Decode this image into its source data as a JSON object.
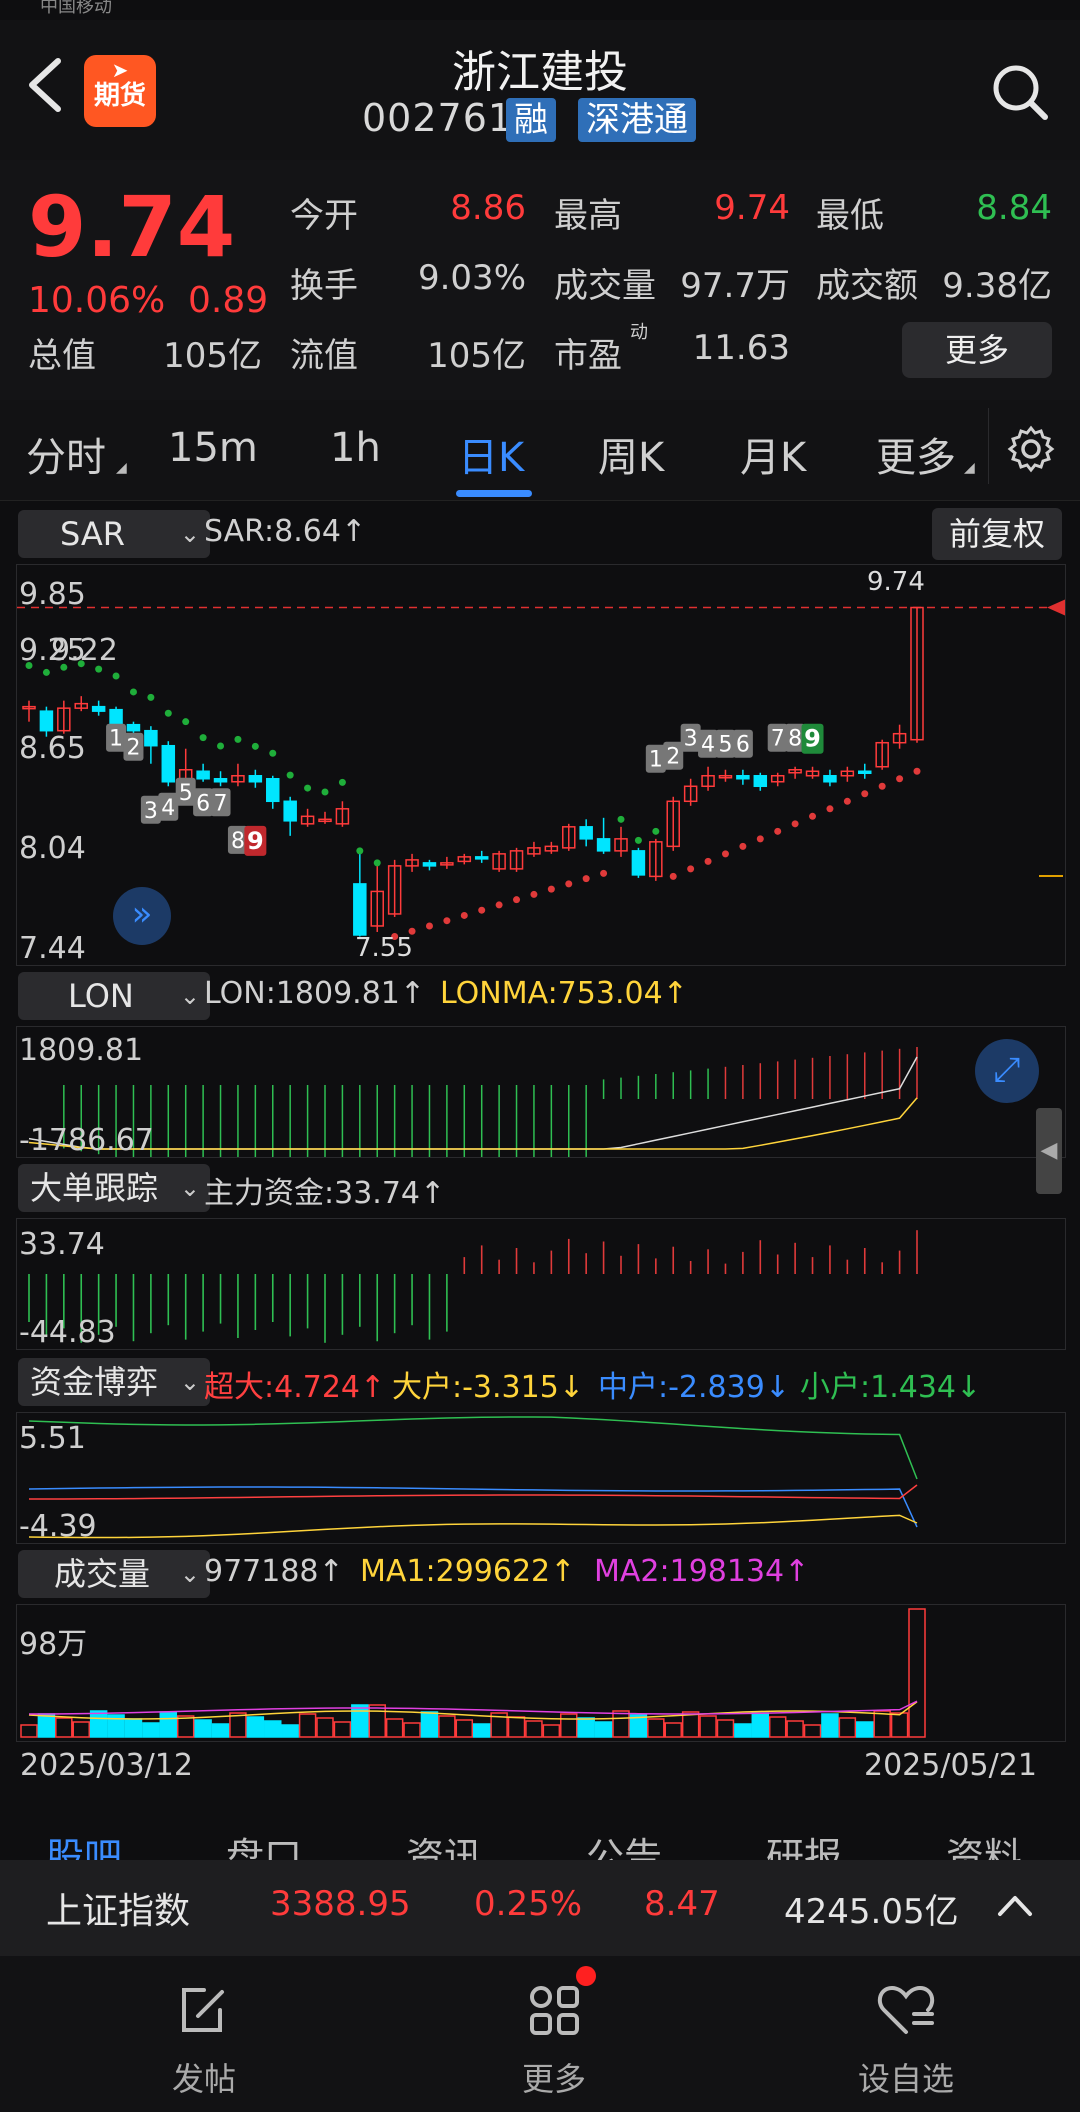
{
  "status": {
    "carrier": "中国移动"
  },
  "header": {
    "title": "浙江建投",
    "code": "002761",
    "tags": [
      "融",
      "深港通"
    ],
    "logo_label": "期货"
  },
  "quote": {
    "price": "9.74",
    "change_pct": "10.06%",
    "change": "0.89",
    "rows": [
      [
        {
          "label": "今开",
          "value": "8.86",
          "color": "red"
        },
        {
          "label": "最高",
          "value": "9.74",
          "color": "red"
        },
        {
          "label": "最低",
          "value": "8.84",
          "color": "green"
        }
      ],
      [
        {
          "label": "换手",
          "value": "9.03%",
          "color": "gray"
        },
        {
          "label": "成交量",
          "value": "97.7万",
          "color": "gray"
        },
        {
          "label": "成交额",
          "value": "9.38亿",
          "color": "gray"
        }
      ],
      [
        {
          "label": "流值",
          "value": "105亿",
          "color": "gray"
        },
        {
          "label": "市盈",
          "value": "11.63",
          "color": "gray"
        }
      ]
    ],
    "total_label": "总值",
    "total_value": "105亿",
    "pe_sup": "动",
    "more_button": "更多"
  },
  "period_tabs": [
    "分时",
    "15m",
    "1h",
    "日K",
    "周K",
    "月K",
    "更多"
  ],
  "active_tab": "日K",
  "sar_panel": {
    "selector": "SAR",
    "info": "SAR:8.64↑",
    "adjust_button": "前复权",
    "y_ticks": [
      "9.85",
      "9.25",
      "8.65",
      "8.04",
      "7.44"
    ],
    "high_label": "9.74",
    "low_label": "7.55",
    "overlap_label": "9.22"
  },
  "lon_panel": {
    "selector": "LON",
    "info_lon": "LON:1809.81↑",
    "info_lonma": "LONMA:753.04↑",
    "y_top": "1809.81",
    "y_bottom": "-1786.67"
  },
  "big_order_panel": {
    "selector": "大单跟踪",
    "info": "主力资金:33.74↑",
    "y_top": "33.74",
    "y_bottom": "-44.83"
  },
  "fund_game_panel": {
    "selector": "资金博弈",
    "info": [
      {
        "text": "超大:4.724↑",
        "color": "#ff4040"
      },
      {
        "text": "大户:-3.315↓",
        "color": "#ffd43b"
      },
      {
        "text": "中户:-2.839↓",
        "color": "#3a8cff"
      },
      {
        "text": "小户:1.434↓",
        "color": "#2fbf52"
      }
    ],
    "y_top": "5.51",
    "y_bottom": "-4.39"
  },
  "volume_panel": {
    "selector": "成交量",
    "info_vol": "977188↑",
    "info_ma1": "MA1:299622↑",
    "info_ma2": "MA2:198134↑",
    "y_top": "98万"
  },
  "dates": {
    "start": "2025/03/12",
    "end": "2025/05/21"
  },
  "bottom_tabs": [
    "股吧",
    "盘口",
    "资讯",
    "公告",
    "研报",
    "资料"
  ],
  "index_bar": {
    "name": "上证指数",
    "value": "3388.95",
    "pct": "0.25%",
    "change": "8.47",
    "amount": "4245.05亿"
  },
  "nav": [
    "发帖",
    "更多",
    "设自选"
  ],
  "colors": {
    "up": "#ff3b3b",
    "down": "#00e5ff",
    "accent": "#3a8cff",
    "sar_up": "#e03a3a",
    "sar_down": "#1fae3a"
  },
  "chart_data": {
    "type": "candlestick",
    "x_range": [
      "2025/03/12",
      "2025/05/21"
    ],
    "ylim": [
      7.44,
      9.85
    ],
    "price_high": 9.74,
    "price_low": 7.55,
    "candles": [
      {
        "o": 9.07,
        "c": 9.08,
        "h": 9.12,
        "l": 8.98
      },
      {
        "o": 9.05,
        "c": 8.92,
        "h": 9.08,
        "l": 8.88
      },
      {
        "o": 8.92,
        "c": 9.07,
        "h": 9.12,
        "l": 8.9
      },
      {
        "o": 9.07,
        "c": 9.1,
        "h": 9.15,
        "l": 9.05
      },
      {
        "o": 9.08,
        "c": 9.05,
        "h": 9.12,
        "l": 9.02
      },
      {
        "o": 9.06,
        "c": 8.96,
        "h": 9.08,
        "l": 8.94
      },
      {
        "o": 8.96,
        "c": 8.92,
        "h": 8.98,
        "l": 8.9
      },
      {
        "o": 8.92,
        "c": 8.82,
        "h": 8.95,
        "l": 8.7
      },
      {
        "o": 8.82,
        "c": 8.58,
        "h": 8.85,
        "l": 8.55
      },
      {
        "o": 8.6,
        "c": 8.66,
        "h": 8.8,
        "l": 8.58
      },
      {
        "o": 8.65,
        "c": 8.6,
        "h": 8.7,
        "l": 8.58
      },
      {
        "o": 8.6,
        "c": 8.58,
        "h": 8.65,
        "l": 8.55
      },
      {
        "o": 8.58,
        "c": 8.62,
        "h": 8.7,
        "l": 8.55
      },
      {
        "o": 8.62,
        "c": 8.58,
        "h": 8.66,
        "l": 8.54
      },
      {
        "o": 8.6,
        "c": 8.45,
        "h": 8.62,
        "l": 8.4
      },
      {
        "o": 8.45,
        "c": 8.32,
        "h": 8.48,
        "l": 8.22
      },
      {
        "o": 8.3,
        "c": 8.35,
        "h": 8.4,
        "l": 8.28
      },
      {
        "o": 8.33,
        "c": 8.33,
        "h": 8.38,
        "l": 8.3
      },
      {
        "o": 8.3,
        "c": 8.4,
        "h": 8.45,
        "l": 8.28
      },
      {
        "o": 7.9,
        "c": 7.56,
        "h": 8.1,
        "l": 7.55
      },
      {
        "o": 7.62,
        "c": 7.85,
        "h": 8.02,
        "l": 7.58
      },
      {
        "o": 7.7,
        "c": 8.02,
        "h": 8.06,
        "l": 7.68
      },
      {
        "o": 8.02,
        "c": 8.06,
        "h": 8.1,
        "l": 7.98
      },
      {
        "o": 8.04,
        "c": 8.02,
        "h": 8.06,
        "l": 7.99
      },
      {
        "o": 8.03,
        "c": 8.04,
        "h": 8.08,
        "l": 8.0
      },
      {
        "o": 8.05,
        "c": 8.08,
        "h": 8.1,
        "l": 8.03
      },
      {
        "o": 8.08,
        "c": 8.07,
        "h": 8.12,
        "l": 8.04
      },
      {
        "o": 8.0,
        "c": 8.1,
        "h": 8.12,
        "l": 7.98
      },
      {
        "o": 8.0,
        "c": 8.12,
        "h": 8.14,
        "l": 7.98
      },
      {
        "o": 8.1,
        "c": 8.14,
        "h": 8.18,
        "l": 8.08
      },
      {
        "o": 8.12,
        "c": 8.15,
        "h": 8.18,
        "l": 8.1
      },
      {
        "o": 8.14,
        "c": 8.28,
        "h": 8.3,
        "l": 8.12
      },
      {
        "o": 8.28,
        "c": 8.2,
        "h": 8.33,
        "l": 8.15
      },
      {
        "o": 8.2,
        "c": 8.12,
        "h": 8.34,
        "l": 8.1
      },
      {
        "o": 8.12,
        "c": 8.2,
        "h": 8.28,
        "l": 8.08
      },
      {
        "o": 8.12,
        "c": 7.96,
        "h": 8.14,
        "l": 7.94
      },
      {
        "o": 7.95,
        "c": 8.18,
        "h": 8.2,
        "l": 7.92
      },
      {
        "o": 8.15,
        "c": 8.45,
        "h": 8.48,
        "l": 8.12
      },
      {
        "o": 8.45,
        "c": 8.55,
        "h": 8.6,
        "l": 8.42
      },
      {
        "o": 8.55,
        "c": 8.62,
        "h": 8.68,
        "l": 8.52
      },
      {
        "o": 8.62,
        "c": 8.62,
        "h": 8.66,
        "l": 8.58
      },
      {
        "o": 8.62,
        "c": 8.6,
        "h": 8.66,
        "l": 8.56
      },
      {
        "o": 8.62,
        "c": 8.55,
        "h": 8.64,
        "l": 8.52
      },
      {
        "o": 8.58,
        "c": 8.62,
        "h": 8.64,
        "l": 8.55
      },
      {
        "o": 8.64,
        "c": 8.66,
        "h": 8.68,
        "l": 8.6
      },
      {
        "o": 8.62,
        "c": 8.65,
        "h": 8.68,
        "l": 8.6
      },
      {
        "o": 8.62,
        "c": 8.58,
        "h": 8.66,
        "l": 8.55
      },
      {
        "o": 8.62,
        "c": 8.65,
        "h": 8.68,
        "l": 8.58
      },
      {
        "o": 8.65,
        "c": 8.64,
        "h": 8.7,
        "l": 8.6
      },
      {
        "o": 8.68,
        "c": 8.84,
        "h": 8.86,
        "l": 8.66
      },
      {
        "o": 8.84,
        "c": 8.9,
        "h": 8.96,
        "l": 8.8
      },
      {
        "o": 8.86,
        "c": 9.74,
        "h": 9.74,
        "l": 8.84
      }
    ]
  }
}
